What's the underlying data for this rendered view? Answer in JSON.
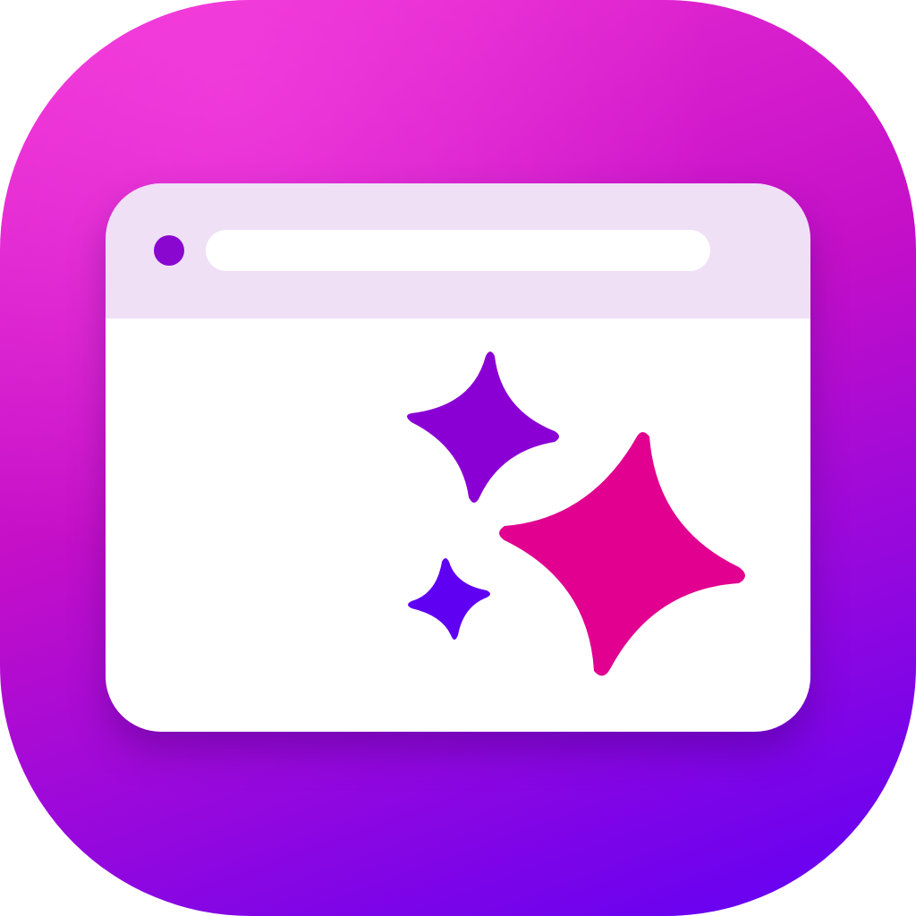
{
  "colors": {
    "bg_top_left": "#f033d4",
    "bg_mid": "#c40fc8",
    "bg_bottom_right": "#5f00f5",
    "header": "#efe0f6",
    "body": "#ffffff",
    "dot": "#8a07d0",
    "address_bar": "#ffffff",
    "sparkle_large": "#e1008f",
    "sparkle_medium": "#8a00d4",
    "sparkle_small": "#5f00f2"
  },
  "icons": {
    "app": "app-icon",
    "window": "browser-window-icon",
    "sparkle": "sparkle-icon"
  }
}
